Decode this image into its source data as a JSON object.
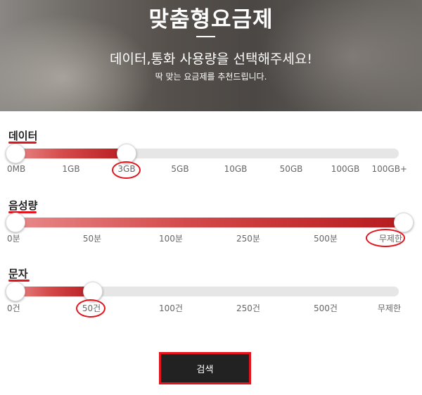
{
  "hero": {
    "title": "맞춤형요금제",
    "subtitle": "데이터,통화 사용량을 선택해주세요!",
    "description": "딱 맞는 요금제를 추천드립니다."
  },
  "sliders": {
    "data": {
      "label": "데이터",
      "ticks": [
        "0MB",
        "1GB",
        "3GB",
        "5GB",
        "10GB",
        "50GB",
        "100GB",
        "100GB+"
      ],
      "selected_index": 2,
      "selected_value": "3GB"
    },
    "voice": {
      "label": "음성량",
      "ticks": [
        "0분",
        "50분",
        "100분",
        "250분",
        "500분",
        "무제한"
      ],
      "selected_index": 5,
      "selected_value": "무제한"
    },
    "sms": {
      "label": "문자",
      "ticks": [
        "0건",
        "50건",
        "100건",
        "250건",
        "500건",
        "무제한"
      ],
      "selected_index": 1,
      "selected_value": "50건"
    }
  },
  "search_button": {
    "label": "검색"
  },
  "colors": {
    "accent": "#e2141d",
    "fill_dark": "#b71b1e",
    "button_bg": "#222222",
    "track": "#e6e6e6"
  }
}
